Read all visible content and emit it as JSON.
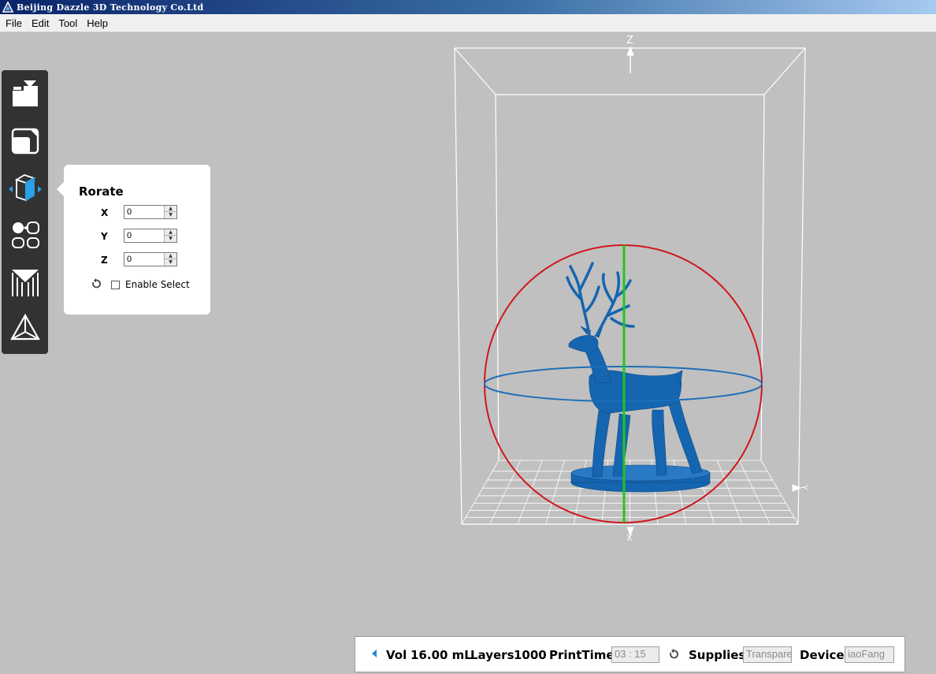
{
  "window": {
    "title": "Beijing Dazzle 3D Technology Co.Ltd"
  },
  "menu": {
    "items": [
      "File",
      "Edit",
      "Tool",
      "Help"
    ]
  },
  "toolbar": {
    "tools": [
      {
        "icon": "open-file-icon"
      },
      {
        "icon": "scale-icon"
      },
      {
        "icon": "rotate-icon",
        "active": true
      },
      {
        "icon": "arrange-icon"
      },
      {
        "icon": "support-icon"
      },
      {
        "icon": "slice-icon"
      }
    ],
    "accent_color": "#29a0e8"
  },
  "rotate_panel": {
    "title": "Rorate",
    "x_label": "X",
    "y_label": "Y",
    "z_label": "Z",
    "x_value": "0",
    "y_value": "0",
    "z_value": "0",
    "enable_select_label": "Enable Select",
    "enable_select_checked": false
  },
  "viewport": {
    "axis_z_label": "Z",
    "axis_x_label": "X",
    "axis_y_label": "Y",
    "model_color": "#1565b0",
    "ring_color_red": "#d0161a",
    "ring_color_blue": "#1e6fb8",
    "axis_color_green": "#1ec81e"
  },
  "status": {
    "vol_label": "Vol",
    "vol_value": "16.00 mL",
    "layers_label": "Layers",
    "layers_value": "1000",
    "printtime_label": "PrintTime",
    "printtime_value": "03 : 15",
    "supplies_label": "Supplies",
    "supplies_value": "Transpare",
    "device_label": "Device",
    "device_value": "iaoFang"
  }
}
